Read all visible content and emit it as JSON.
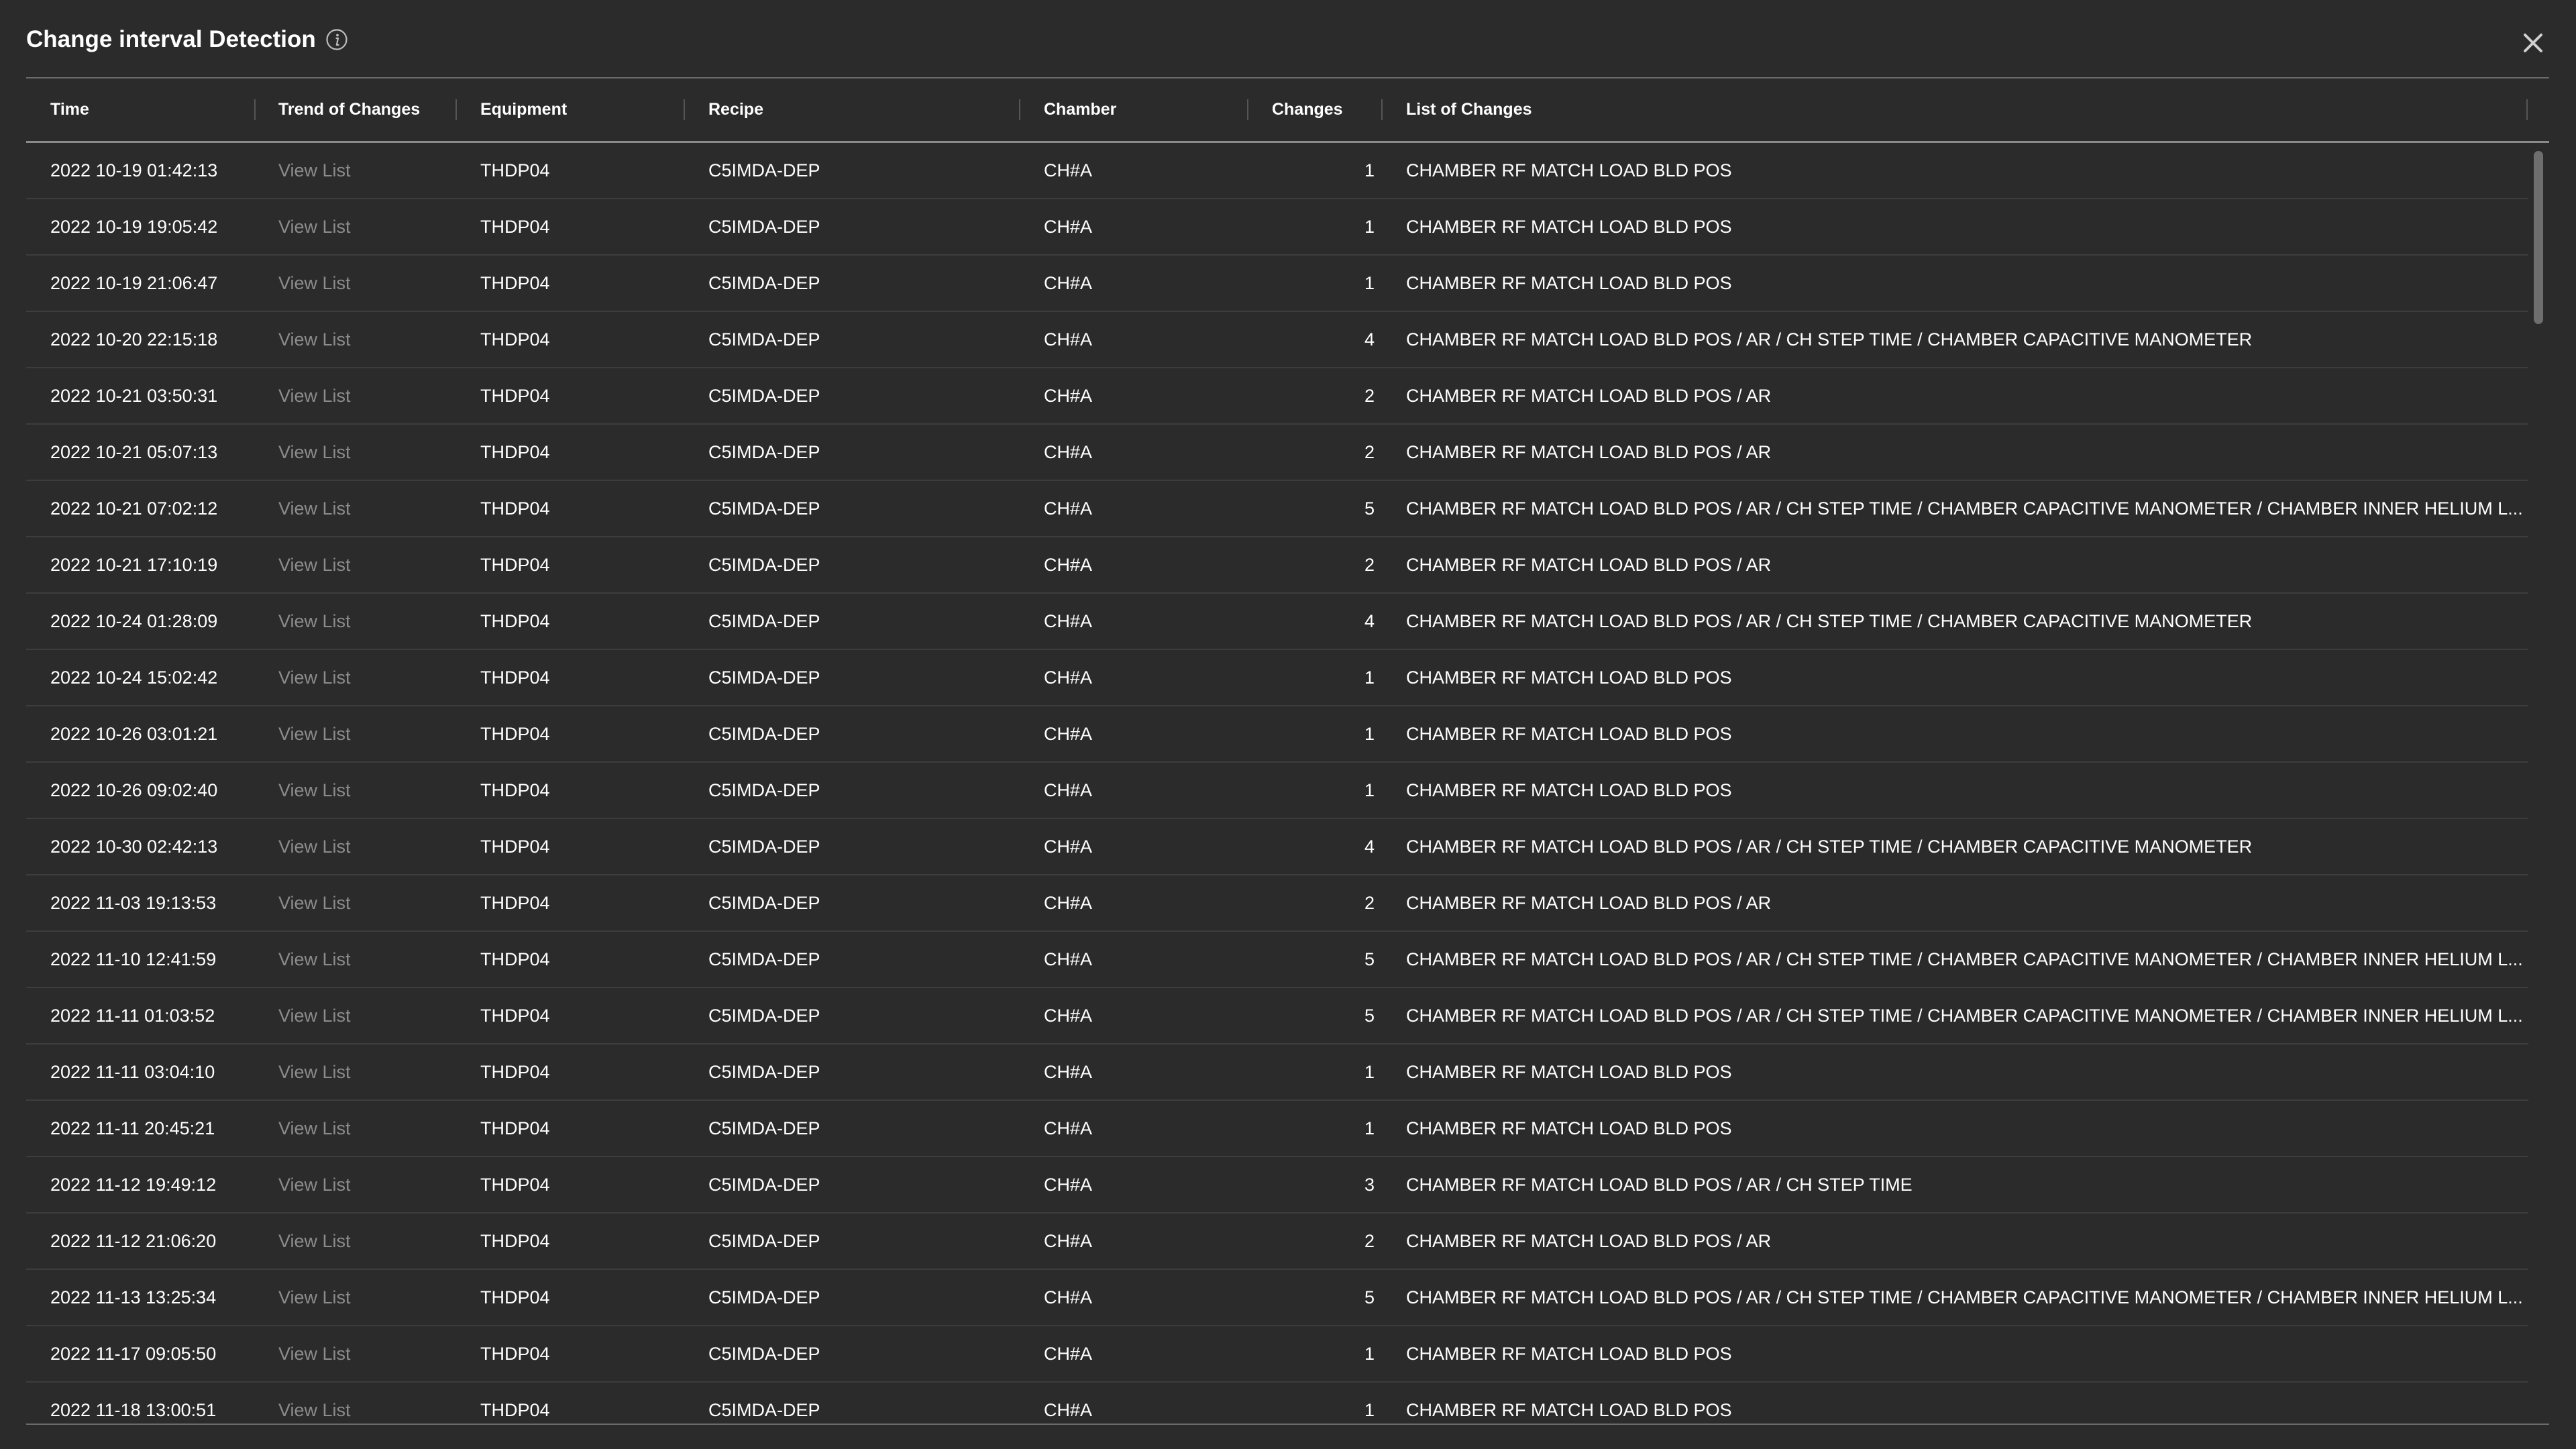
{
  "dialog": {
    "title": "Change interval Detection",
    "info_icon": "info-icon",
    "close_icon": "close-icon"
  },
  "table": {
    "columns": [
      "Time",
      "Trend of Changes",
      "Equipment",
      "Recipe",
      "Chamber",
      "Changes",
      "List of Changes"
    ],
    "rows": [
      {
        "time": "2022 10-19 01:42:13",
        "trend": "View List",
        "equipment": "THDP04",
        "recipe": "C5IMDA-DEP",
        "chamber": "CH#A",
        "changes": "1",
        "list": "CHAMBER RF MATCH LOAD BLD POS"
      },
      {
        "time": "2022 10-19 19:05:42",
        "trend": "View List",
        "equipment": "THDP04",
        "recipe": "C5IMDA-DEP",
        "chamber": "CH#A",
        "changes": "1",
        "list": "CHAMBER RF MATCH LOAD BLD POS"
      },
      {
        "time": "2022 10-19 21:06:47",
        "trend": "View List",
        "equipment": "THDP04",
        "recipe": "C5IMDA-DEP",
        "chamber": "CH#A",
        "changes": "1",
        "list": "CHAMBER RF MATCH LOAD BLD POS"
      },
      {
        "time": "2022 10-20 22:15:18",
        "trend": "View List",
        "equipment": "THDP04",
        "recipe": "C5IMDA-DEP",
        "chamber": "CH#A",
        "changes": "4",
        "list": "CHAMBER RF MATCH LOAD BLD POS / AR / CH STEP TIME / CHAMBER CAPACITIVE MANOMETER"
      },
      {
        "time": "2022 10-21 03:50:31",
        "trend": "View List",
        "equipment": "THDP04",
        "recipe": "C5IMDA-DEP",
        "chamber": "CH#A",
        "changes": "2",
        "list": "CHAMBER RF MATCH LOAD BLD POS / AR"
      },
      {
        "time": "2022 10-21 05:07:13",
        "trend": "View List",
        "equipment": "THDP04",
        "recipe": "C5IMDA-DEP",
        "chamber": "CH#A",
        "changes": "2",
        "list": "CHAMBER RF MATCH LOAD BLD POS / AR"
      },
      {
        "time": "2022 10-21 07:02:12",
        "trend": "View List",
        "equipment": "THDP04",
        "recipe": "C5IMDA-DEP",
        "chamber": "CH#A",
        "changes": "5",
        "list": "CHAMBER RF MATCH LOAD BLD POS / AR / CH STEP TIME / CHAMBER CAPACITIVE MANOMETER / CHAMBER INNER HELIUM L..."
      },
      {
        "time": "2022 10-21 17:10:19",
        "trend": "View List",
        "equipment": "THDP04",
        "recipe": "C5IMDA-DEP",
        "chamber": "CH#A",
        "changes": "2",
        "list": "CHAMBER RF MATCH LOAD BLD POS / AR"
      },
      {
        "time": "2022 10-24 01:28:09",
        "trend": "View List",
        "equipment": "THDP04",
        "recipe": "C5IMDA-DEP",
        "chamber": "CH#A",
        "changes": "4",
        "list": "CHAMBER RF MATCH LOAD BLD POS / AR / CH STEP TIME / CHAMBER CAPACITIVE MANOMETER"
      },
      {
        "time": "2022 10-24 15:02:42",
        "trend": "View List",
        "equipment": "THDP04",
        "recipe": "C5IMDA-DEP",
        "chamber": "CH#A",
        "changes": "1",
        "list": "CHAMBER RF MATCH LOAD BLD POS"
      },
      {
        "time": "2022 10-26 03:01:21",
        "trend": "View List",
        "equipment": "THDP04",
        "recipe": "C5IMDA-DEP",
        "chamber": "CH#A",
        "changes": "1",
        "list": "CHAMBER RF MATCH LOAD BLD POS"
      },
      {
        "time": "2022 10-26 09:02:40",
        "trend": "View List",
        "equipment": "THDP04",
        "recipe": "C5IMDA-DEP",
        "chamber": "CH#A",
        "changes": "1",
        "list": "CHAMBER RF MATCH LOAD BLD POS"
      },
      {
        "time": "2022 10-30 02:42:13",
        "trend": "View List",
        "equipment": "THDP04",
        "recipe": "C5IMDA-DEP",
        "chamber": "CH#A",
        "changes": "4",
        "list": "CHAMBER RF MATCH LOAD BLD POS / AR / CH STEP TIME / CHAMBER CAPACITIVE MANOMETER"
      },
      {
        "time": "2022 11-03 19:13:53",
        "trend": "View List",
        "equipment": "THDP04",
        "recipe": "C5IMDA-DEP",
        "chamber": "CH#A",
        "changes": "2",
        "list": "CHAMBER RF MATCH LOAD BLD POS / AR"
      },
      {
        "time": "2022 11-10 12:41:59",
        "trend": "View List",
        "equipment": "THDP04",
        "recipe": "C5IMDA-DEP",
        "chamber": "CH#A",
        "changes": "5",
        "list": "CHAMBER RF MATCH LOAD BLD POS / AR / CH STEP TIME / CHAMBER CAPACITIVE MANOMETER / CHAMBER INNER HELIUM L..."
      },
      {
        "time": "2022 11-11 01:03:52",
        "trend": "View List",
        "equipment": "THDP04",
        "recipe": "C5IMDA-DEP",
        "chamber": "CH#A",
        "changes": "5",
        "list": "CHAMBER RF MATCH LOAD BLD POS / AR / CH STEP TIME / CHAMBER CAPACITIVE MANOMETER / CHAMBER INNER HELIUM L..."
      },
      {
        "time": "2022 11-11 03:04:10",
        "trend": "View List",
        "equipment": "THDP04",
        "recipe": "C5IMDA-DEP",
        "chamber": "CH#A",
        "changes": "1",
        "list": "CHAMBER RF MATCH LOAD BLD POS"
      },
      {
        "time": "2022 11-11 20:45:21",
        "trend": "View List",
        "equipment": "THDP04",
        "recipe": "C5IMDA-DEP",
        "chamber": "CH#A",
        "changes": "1",
        "list": "CHAMBER RF MATCH LOAD BLD POS"
      },
      {
        "time": "2022 11-12 19:49:12",
        "trend": "View List",
        "equipment": "THDP04",
        "recipe": "C5IMDA-DEP",
        "chamber": "CH#A",
        "changes": "3",
        "list": "CHAMBER RF MATCH LOAD BLD POS / AR / CH STEP TIME"
      },
      {
        "time": "2022 11-12 21:06:20",
        "trend": "View List",
        "equipment": "THDP04",
        "recipe": "C5IMDA-DEP",
        "chamber": "CH#A",
        "changes": "2",
        "list": "CHAMBER RF MATCH LOAD BLD POS / AR"
      },
      {
        "time": "2022 11-13 13:25:34",
        "trend": "View List",
        "equipment": "THDP04",
        "recipe": "C5IMDA-DEP",
        "chamber": "CH#A",
        "changes": "5",
        "list": "CHAMBER RF MATCH LOAD BLD POS / AR / CH STEP TIME / CHAMBER CAPACITIVE MANOMETER / CHAMBER INNER HELIUM L..."
      },
      {
        "time": "2022 11-17 09:05:50",
        "trend": "View List",
        "equipment": "THDP04",
        "recipe": "C5IMDA-DEP",
        "chamber": "CH#A",
        "changes": "1",
        "list": "CHAMBER RF MATCH LOAD BLD POS"
      },
      {
        "time": "2022 11-18 13:00:51",
        "trend": "View List",
        "equipment": "THDP04",
        "recipe": "C5IMDA-DEP",
        "chamber": "CH#A",
        "changes": "1",
        "list": "CHAMBER RF MATCH LOAD BLD POS"
      }
    ]
  },
  "colors": {
    "background": "#2b2b2b",
    "text": "#ffffff",
    "link_muted": "#8c8c8c",
    "row_divider": "#3d3d3d",
    "scroll_thumb": "#6e6e6e"
  }
}
